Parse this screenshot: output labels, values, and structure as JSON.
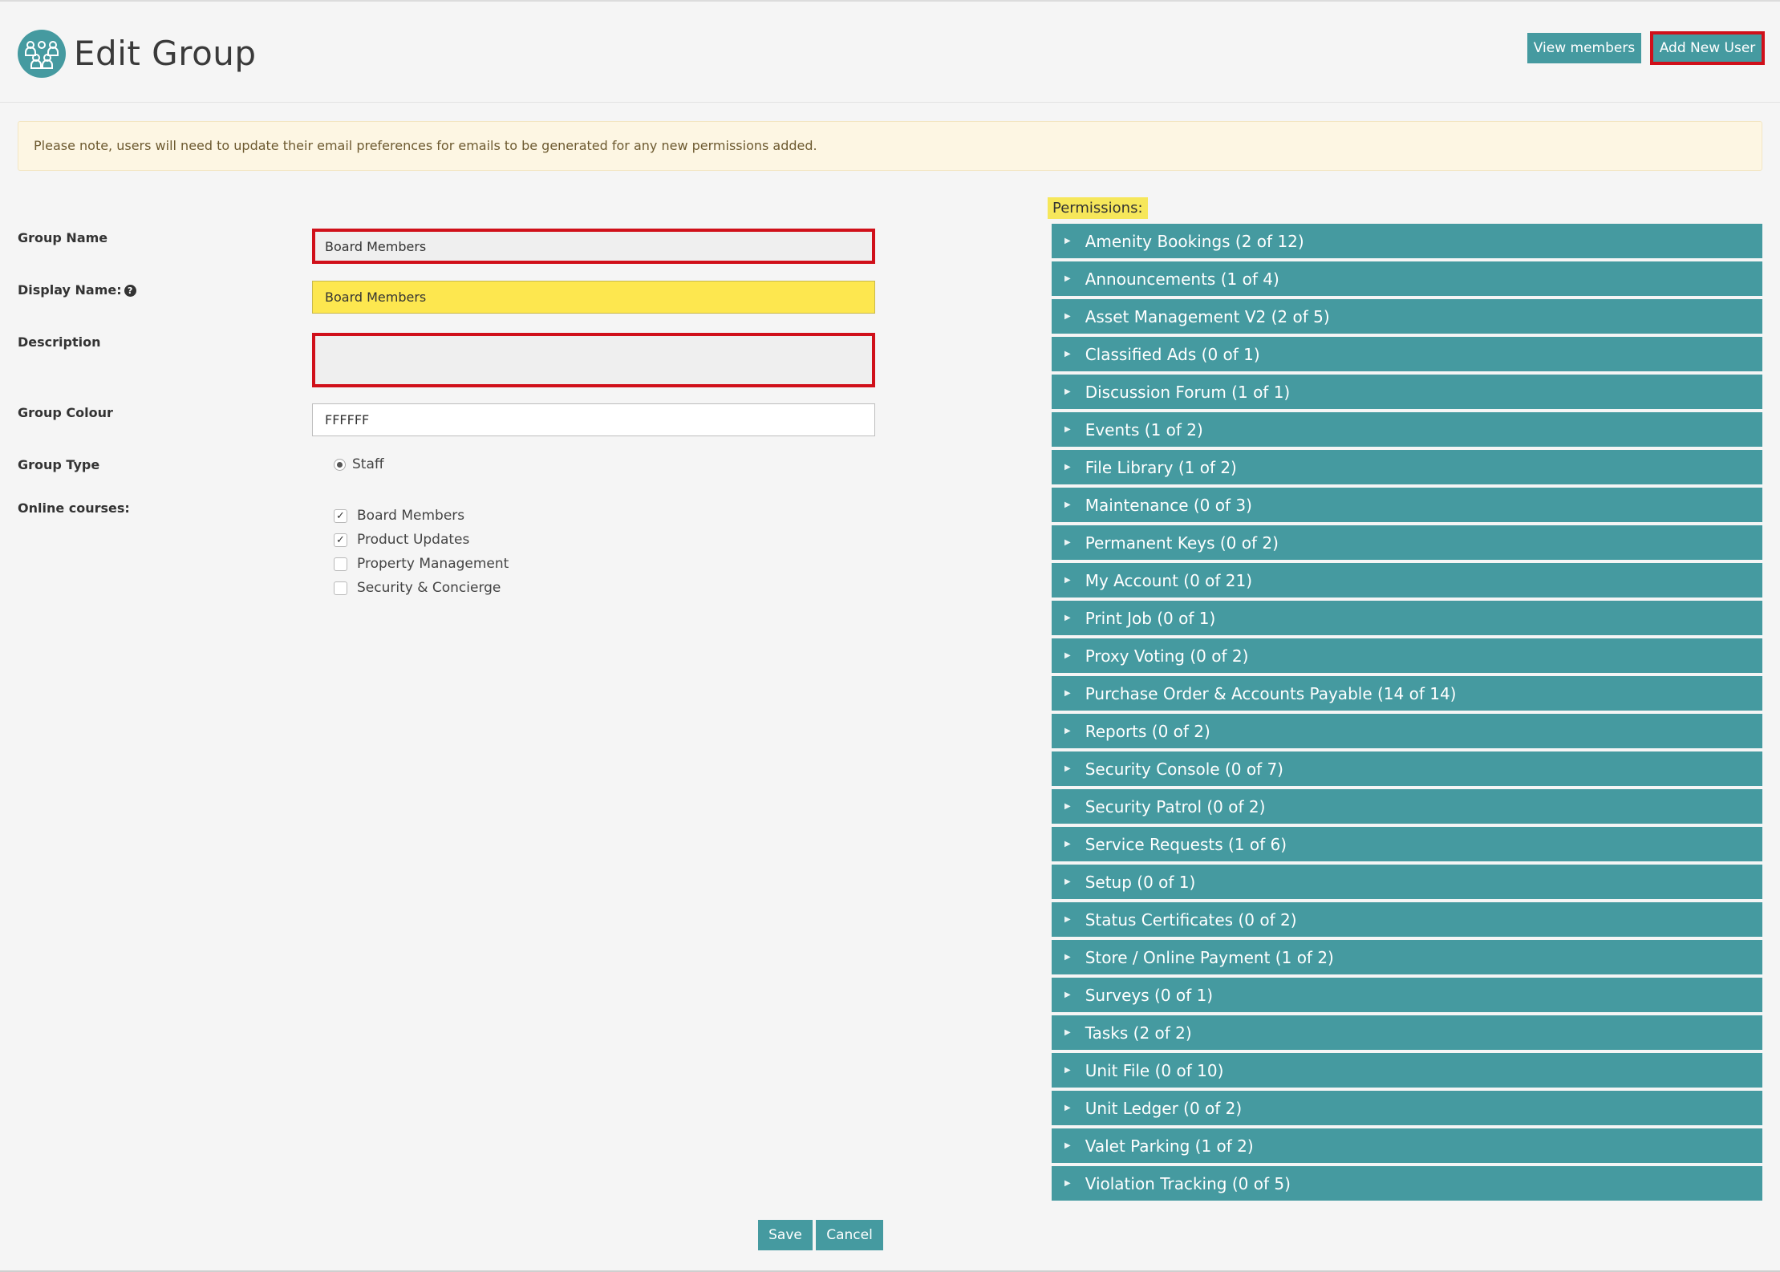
{
  "header": {
    "title": "Edit Group",
    "view_members": "View members",
    "add_new_user": "Add New User"
  },
  "notice": "Please note, users will need to update their email preferences for emails to be generated for any new permissions added.",
  "form": {
    "group_name_label": "Group Name",
    "group_name_value": "Board Members",
    "display_name_label": "Display Name:",
    "display_name_value": "Board Members",
    "description_label": "Description",
    "description_value": "",
    "group_colour_label": "Group Colour",
    "group_colour_value": "FFFFFF",
    "group_type_label": "Group Type",
    "group_type_option": "Staff",
    "online_courses_label": "Online courses:",
    "courses": [
      {
        "label": "Board Members",
        "checked": true
      },
      {
        "label": "Product Updates",
        "checked": true
      },
      {
        "label": "Property Management",
        "checked": false
      },
      {
        "label": "Security & Concierge",
        "checked": false
      }
    ]
  },
  "permissions": {
    "label": "Permissions:",
    "items": [
      "Amenity Bookings (2 of 12)",
      "Announcements (1 of 4)",
      "Asset Management V2 (2 of 5)",
      "Classified Ads (0 of 1)",
      "Discussion Forum (1 of 1)",
      "Events (1 of 2)",
      "File Library (1 of 2)",
      "Maintenance (0 of 3)",
      "Permanent Keys (0 of 2)",
      "My Account (0 of 21)",
      "Print Job (0 of 1)",
      "Proxy Voting (0 of 2)",
      "Purchase Order & Accounts Payable (14 of 14)",
      "Reports (0 of 2)",
      "Security Console (0 of 7)",
      "Security Patrol (0 of 2)",
      "Service Requests (1 of 6)",
      "Setup (0 of 1)",
      "Status Certificates (0 of 2)",
      "Store / Online Payment (1 of 2)",
      "Surveys (0 of 1)",
      "Tasks (2 of 2)",
      "Unit File (0 of 10)",
      "Unit Ledger (0 of 2)",
      "Valet Parking (1 of 2)",
      "Violation Tracking (0 of 5)"
    ]
  },
  "actions": {
    "save": "Save",
    "cancel": "Cancel"
  },
  "colors": {
    "accent": "#459aa0",
    "highlight": "#fde74f",
    "alert_border": "#d0101a",
    "notice_bg": "#fdf6e3"
  }
}
